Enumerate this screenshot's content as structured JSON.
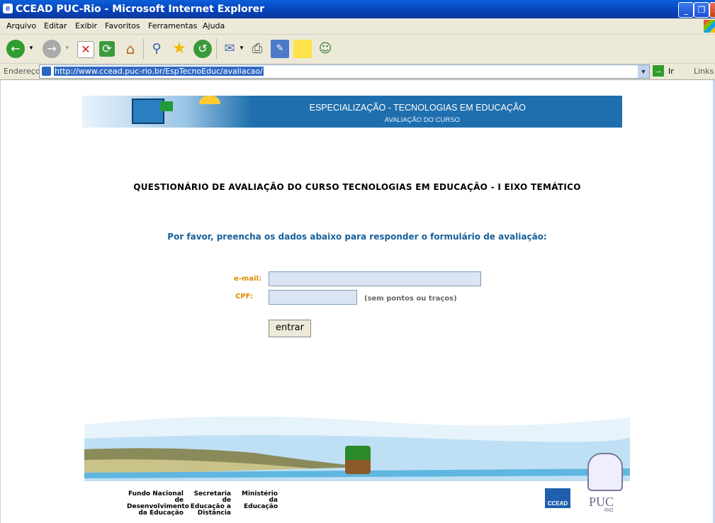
{
  "window": {
    "title": "CCEAD PUC-Rio - Microsoft Internet Explorer",
    "minimize": "_",
    "maximize": "❐",
    "close": "✕"
  },
  "menu": [
    "Arquivo",
    "Editar",
    "Exibir",
    "Favoritos",
    "Ferramentas",
    "Ajuda"
  ],
  "address": {
    "label": "Endereço",
    "url": "http://www.ccead.puc-rio.br/EspTecnoEduc/avaliacao/",
    "go": "Ir",
    "links": "Links"
  },
  "banner": {
    "title": "ESPECIALIZAÇÃO - TECNOLOGIAS EM EDUCAÇÃO",
    "subtitle": "AVALIAÇÃO DO CURSO"
  },
  "heading": "QUESTIONÁRIO DE AVALIAÇÃO DO CURSO TECNOLOGIAS EM EDUCAÇÃO - I EIXO TEMÁTICO",
  "instruction": "Por favor, preencha os dados abaixo para responder o formulário de avaliação:",
  "form": {
    "email_label": "e-mail:",
    "email_value": "",
    "cpf_label": "CPF:",
    "cpf_value": "",
    "cpf_hint": "(sem pontos ou traços)",
    "submit": "entrar"
  },
  "footer": {
    "fnde": [
      "Fundo Nacional de",
      "Desenvolvimento",
      "da Educação"
    ],
    "seed": [
      "Secretaria de",
      "Educação a",
      "Distância"
    ],
    "mec": [
      "Ministério",
      "da Educação"
    ],
    "ccead": "CCEAD",
    "puc": "PUC",
    "rio": "RIO"
  }
}
